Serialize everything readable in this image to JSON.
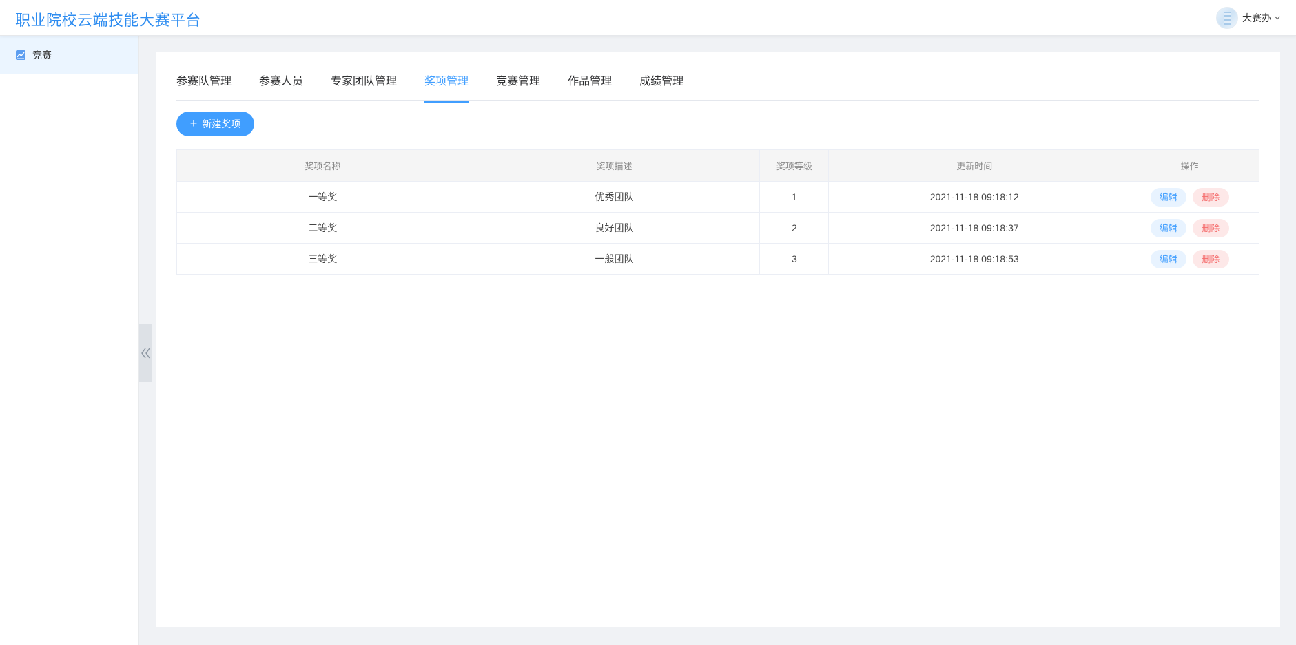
{
  "app": {
    "title": "职业院校云端技能大赛平台"
  },
  "user": {
    "name": "大赛办"
  },
  "sidebar": {
    "items": [
      {
        "label": "竞赛",
        "icon": "chart-icon"
      }
    ]
  },
  "tabs": [
    {
      "label": "参赛队管理",
      "active": false
    },
    {
      "label": "参赛人员",
      "active": false
    },
    {
      "label": "专家团队管理",
      "active": false
    },
    {
      "label": "奖项管理",
      "active": true
    },
    {
      "label": "竞赛管理",
      "active": false
    },
    {
      "label": "作品管理",
      "active": false
    },
    {
      "label": "成绩管理",
      "active": false
    }
  ],
  "toolbar": {
    "new_label": "新建奖项"
  },
  "table": {
    "columns": [
      "奖项名称",
      "奖项描述",
      "奖项等级",
      "更新时间",
      "操作"
    ],
    "rows": [
      {
        "name": "一等奖",
        "desc": "优秀团队",
        "level": "1",
        "updated": "2021-11-18 09:18:12"
      },
      {
        "name": "二等奖",
        "desc": "良好团队",
        "level": "2",
        "updated": "2021-11-18 09:18:37"
      },
      {
        "name": "三等奖",
        "desc": "一般团队",
        "level": "3",
        "updated": "2021-11-18 09:18:53"
      }
    ],
    "actions": {
      "edit": "编辑",
      "delete": "删除"
    }
  },
  "colors": {
    "accent": "#409eff",
    "title": "#2d8cf0",
    "danger": "#f56c6c"
  }
}
